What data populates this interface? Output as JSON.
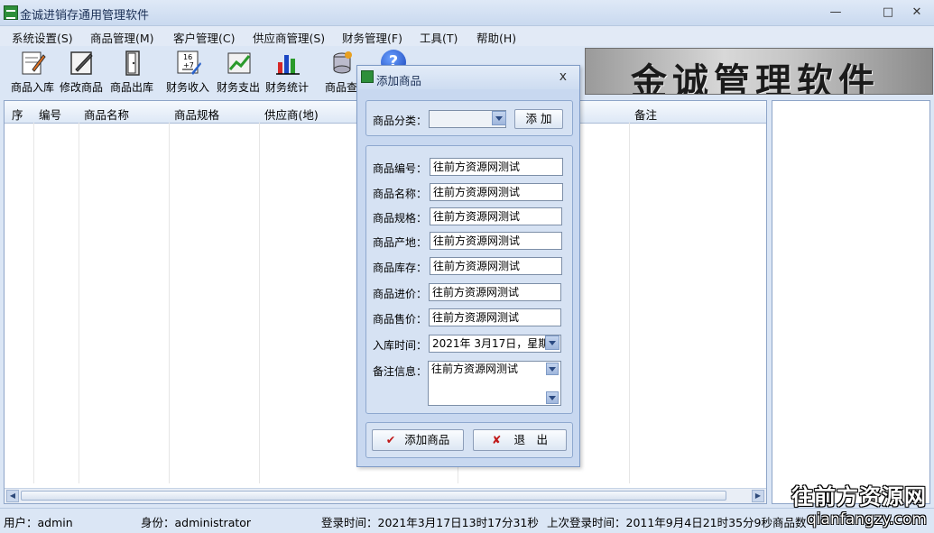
{
  "window": {
    "title": "金诚进销存通用管理软件",
    "min": "—",
    "max": "□",
    "close": "✕"
  },
  "menu": [
    "系统设置(S)",
    "商品管理(M)",
    "客户管理(C)",
    "供应商管理(S)",
    "财务管理(F)",
    "工具(T)",
    "帮助(H)"
  ],
  "toolbar": [
    {
      "label": "商品入库",
      "icon": "stock-in-icon"
    },
    {
      "label": "修改商品",
      "icon": "edit-product-icon"
    },
    {
      "label": "商品出库",
      "icon": "stock-out-icon"
    },
    {
      "label": "财务收入",
      "icon": "finance-income-icon"
    },
    {
      "label": "财务支出",
      "icon": "finance-expense-icon"
    },
    {
      "label": "财务统计",
      "icon": "finance-stats-icon"
    },
    {
      "label": "商品查",
      "icon": "product-query-icon"
    }
  ],
  "banner": {
    "text": "金诚管理软件"
  },
  "grid": {
    "columns": [
      "序",
      "编号",
      "商品名称",
      "商品规格",
      "供应商(地)",
      "备注"
    ]
  },
  "status": {
    "user": "用户：admin",
    "role": "身份：administrator",
    "login_time": "登录时间：2021年3月17日13时17分31秒",
    "last_login": "上次登录时间：2011年9月4日21时35分9秒",
    "count": "商品数"
  },
  "dialog": {
    "title": "添加商品",
    "close": "x",
    "category_label": "商品分类：",
    "category_value": "",
    "add_category_button": "添 加",
    "fields": [
      {
        "label": "商品编号：",
        "value": "往前方资源网测试"
      },
      {
        "label": "商品名称：",
        "value": "往前方资源网测试"
      },
      {
        "label": "商品规格：",
        "value": "往前方资源网测试"
      },
      {
        "label": "商品产地：",
        "value": "往前方资源网测试"
      },
      {
        "label": "商品库存：",
        "value": "往前方资源网测试"
      },
      {
        "label": "商品进价：",
        "value": "往前方资源网测试"
      },
      {
        "label": "商品售价：",
        "value": "往前方资源网测试"
      }
    ],
    "date_label": "入库时间：",
    "date_value": "2021年 3月17日，星期",
    "note_label": "备注信息：",
    "note_value": "往前方资源网测试",
    "add_button": "添加商品",
    "exit_button": "退　出"
  },
  "watermark": {
    "line1": "往前方资源网",
    "line2": "qianfangzy.com"
  }
}
